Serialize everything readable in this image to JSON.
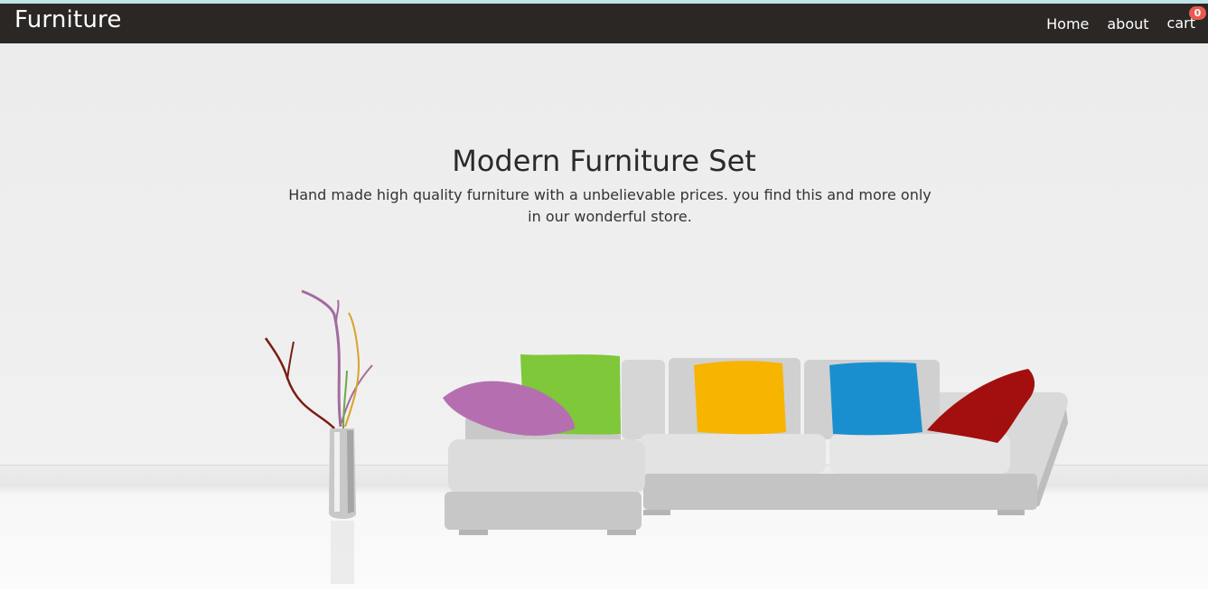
{
  "navbar": {
    "brand": "Furniture",
    "links": {
      "home": "Home",
      "about": "about",
      "cart": "cart"
    },
    "cart_count": "0"
  },
  "hero": {
    "title": "Modern Furniture Set",
    "subtitle": "Hand made high quality furniture with a unbelievable prices. you find this and more only in our wonderful store."
  },
  "colors": {
    "navbar_bg": "#2b2725",
    "badge": "#e85a4f",
    "pillow_purple": "#b56fb0",
    "pillow_green": "#7ec83a",
    "pillow_yellow": "#f7b400",
    "pillow_blue": "#1a8fcf",
    "pillow_red": "#a30f0f"
  }
}
